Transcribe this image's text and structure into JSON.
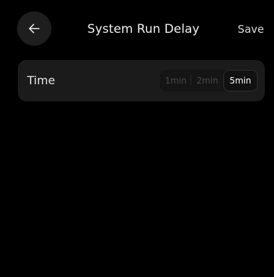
{
  "header": {
    "title": "System Run Delay",
    "save_label": "Save",
    "back_icon": "arrow-left-icon"
  },
  "setting": {
    "label": "Time",
    "options": [
      "1min",
      "2min",
      "5min"
    ],
    "selected": "5min"
  },
  "colors": {
    "background": "#000000",
    "card": "#1b1b1b",
    "active_text": "#ffffff",
    "inactive_text": "#4a4a4a"
  }
}
